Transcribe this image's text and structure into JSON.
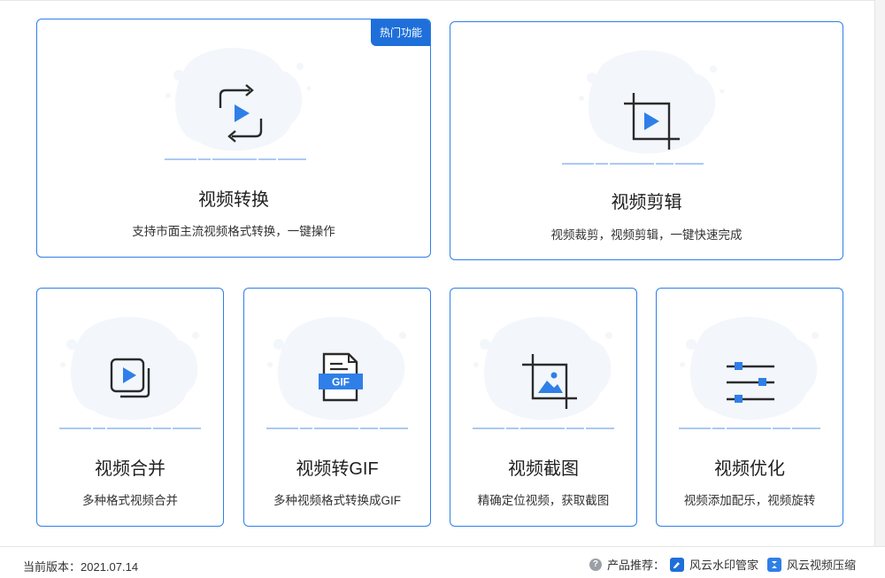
{
  "cards": [
    {
      "title": "视频转换",
      "desc": "支持市面主流视频格式转换，一键操作",
      "badge": "热门功能"
    },
    {
      "title": "视频剪辑",
      "desc": "视频裁剪，视频剪辑，一键快速完成"
    },
    {
      "title": "视频合并",
      "desc": "多种格式视频合并"
    },
    {
      "title": "视频转GIF",
      "desc": "多种视频格式转换成GIF",
      "icon_text": "GIF"
    },
    {
      "title": "视频截图",
      "desc": "精确定位视频，获取截图"
    },
    {
      "title": "视频优化",
      "desc": "视频添加配乐，视频旋转"
    }
  ],
  "footer": {
    "version": "当前版本：2021.07.14",
    "recommend_label": "产品推荐：",
    "products": [
      "风云水印管家",
      "风云视频压缩"
    ]
  },
  "colors": {
    "accent": "#2f7fe8",
    "badge": "#1e6fd9",
    "icon_dark": "#2b2b2b",
    "icon_blue": "#2f7fe8",
    "blob": "#f3f6fb"
  }
}
